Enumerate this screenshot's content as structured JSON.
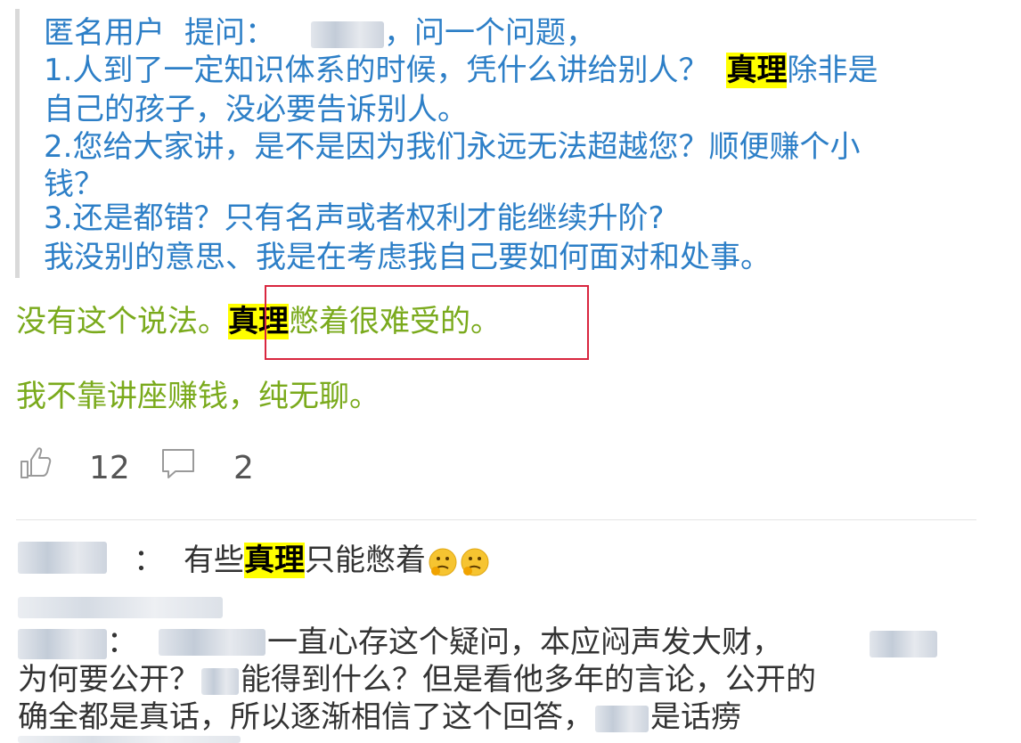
{
  "question": {
    "author_label": "匿名用户",
    "ask_label": "提问：",
    "opening": "，问一个问题，",
    "line1_a": "1.人到了一定知识体系的时候，凭什么讲给别人？",
    "highlight": "真理",
    "line1_b": "除非是",
    "line2": "自己的孩子，没必要告诉别人。",
    "line3": "2.您给大家讲，是不是因为我们永远无法超越您？顺便赚个小",
    "line4": "钱？",
    "line5": "3.还是都错？只有名声或者权利才能继续升阶?",
    "line6": "我没别的意思、我是在考虑我自己要如何面对和处事。"
  },
  "answer": {
    "line1_a": "没有这个说法。",
    "highlight": "真理",
    "line1_b": "憋着很难受的。",
    "line2": "我不靠讲座赚钱，纯无聊。"
  },
  "actions": {
    "like_count": "12",
    "comment_count": "2"
  },
  "comments": [
    {
      "separator": "：",
      "text_a": "有些",
      "highlight": "真理",
      "text_b": "只能憋着"
    },
    {
      "separator": "：",
      "line1": "一直心存这个疑问，本应闷声发大财，",
      "line2_a": "为何要公开？",
      "line2_b": "能得到什么？但是看他多年的言论，公开的",
      "line3_a": "确全都是真话，所以逐渐相信了这个回答，",
      "line3_b": "是话痨"
    }
  ],
  "colors": {
    "question_text": "#2d7fc7",
    "answer_text": "#7aaa1c",
    "highlight": "#ffff00",
    "annotation_box": "#d9263f"
  },
  "icons": [
    "thumbs-up-icon",
    "comment-icon",
    "thinking-face-emoji"
  ]
}
